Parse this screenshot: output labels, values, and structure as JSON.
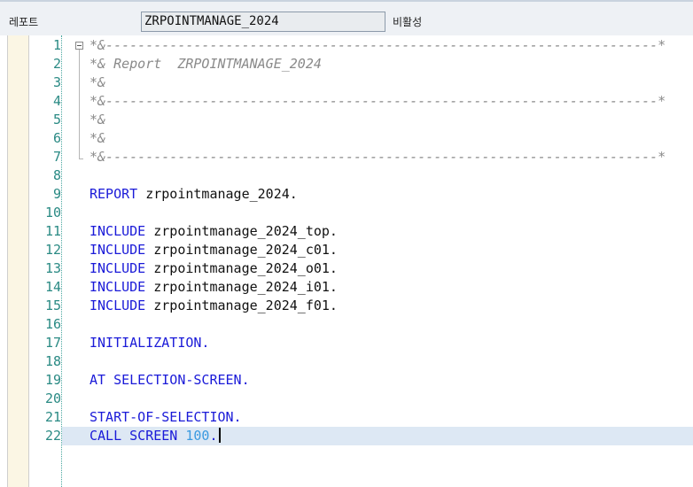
{
  "header": {
    "report_label": "레포트",
    "report_name": "ZRPOINTMANAGE_2024",
    "status": "비활성"
  },
  "editor": {
    "lines": [
      {
        "num": "1",
        "segments": [
          {
            "t": "cmt",
            "text": "*&---------------------------------------------------------------------*"
          }
        ]
      },
      {
        "num": "2",
        "segments": [
          {
            "t": "cmt",
            "text": "*& Report  ZRPOINTMANAGE_2024"
          }
        ]
      },
      {
        "num": "3",
        "segments": [
          {
            "t": "cmt",
            "text": "*&"
          }
        ]
      },
      {
        "num": "4",
        "segments": [
          {
            "t": "cmt",
            "text": "*&---------------------------------------------------------------------*"
          }
        ]
      },
      {
        "num": "5",
        "segments": [
          {
            "t": "cmt",
            "text": "*&"
          }
        ]
      },
      {
        "num": "6",
        "segments": [
          {
            "t": "cmt",
            "text": "*&"
          }
        ]
      },
      {
        "num": "7",
        "segments": [
          {
            "t": "cmt",
            "text": "*&---------------------------------------------------------------------*"
          }
        ]
      },
      {
        "num": "8",
        "segments": []
      },
      {
        "num": "9",
        "segments": [
          {
            "t": "kw",
            "text": "REPORT "
          },
          {
            "t": "txt",
            "text": "zrpointmanage_2024."
          }
        ]
      },
      {
        "num": "10",
        "segments": []
      },
      {
        "num": "11",
        "segments": [
          {
            "t": "kw",
            "text": "INCLUDE "
          },
          {
            "t": "txt",
            "text": "zrpointmanage_2024_top."
          }
        ]
      },
      {
        "num": "12",
        "segments": [
          {
            "t": "kw",
            "text": "INCLUDE "
          },
          {
            "t": "txt",
            "text": "zrpointmanage_2024_c01."
          }
        ]
      },
      {
        "num": "13",
        "segments": [
          {
            "t": "kw",
            "text": "INCLUDE "
          },
          {
            "t": "txt",
            "text": "zrpointmanage_2024_o01."
          }
        ]
      },
      {
        "num": "14",
        "segments": [
          {
            "t": "kw",
            "text": "INCLUDE "
          },
          {
            "t": "txt",
            "text": "zrpointmanage_2024_i01."
          }
        ]
      },
      {
        "num": "15",
        "segments": [
          {
            "t": "kw",
            "text": "INCLUDE "
          },
          {
            "t": "txt",
            "text": "zrpointmanage_2024_f01."
          }
        ]
      },
      {
        "num": "16",
        "segments": []
      },
      {
        "num": "17",
        "segments": [
          {
            "t": "kw",
            "text": "INITIALIZATION."
          }
        ]
      },
      {
        "num": "18",
        "segments": []
      },
      {
        "num": "19",
        "segments": [
          {
            "t": "kw",
            "text": "AT SELECTION-SCREEN."
          }
        ]
      },
      {
        "num": "20",
        "segments": []
      },
      {
        "num": "21",
        "segments": [
          {
            "t": "kw",
            "text": "START-OF-SELECTION."
          }
        ]
      },
      {
        "num": "22",
        "segments": [
          {
            "t": "kw",
            "text": "CALL SCREEN "
          },
          {
            "t": "num",
            "text": "100"
          },
          {
            "t": "kw",
            "text": "."
          }
        ]
      }
    ],
    "current_line": 22
  },
  "colors": {
    "keyword": "#1a1ad8",
    "comment": "#8a8a8a",
    "number": "#3a9ae0",
    "line_number": "#2a8a84",
    "current_line_bg": "#dde8f4"
  }
}
